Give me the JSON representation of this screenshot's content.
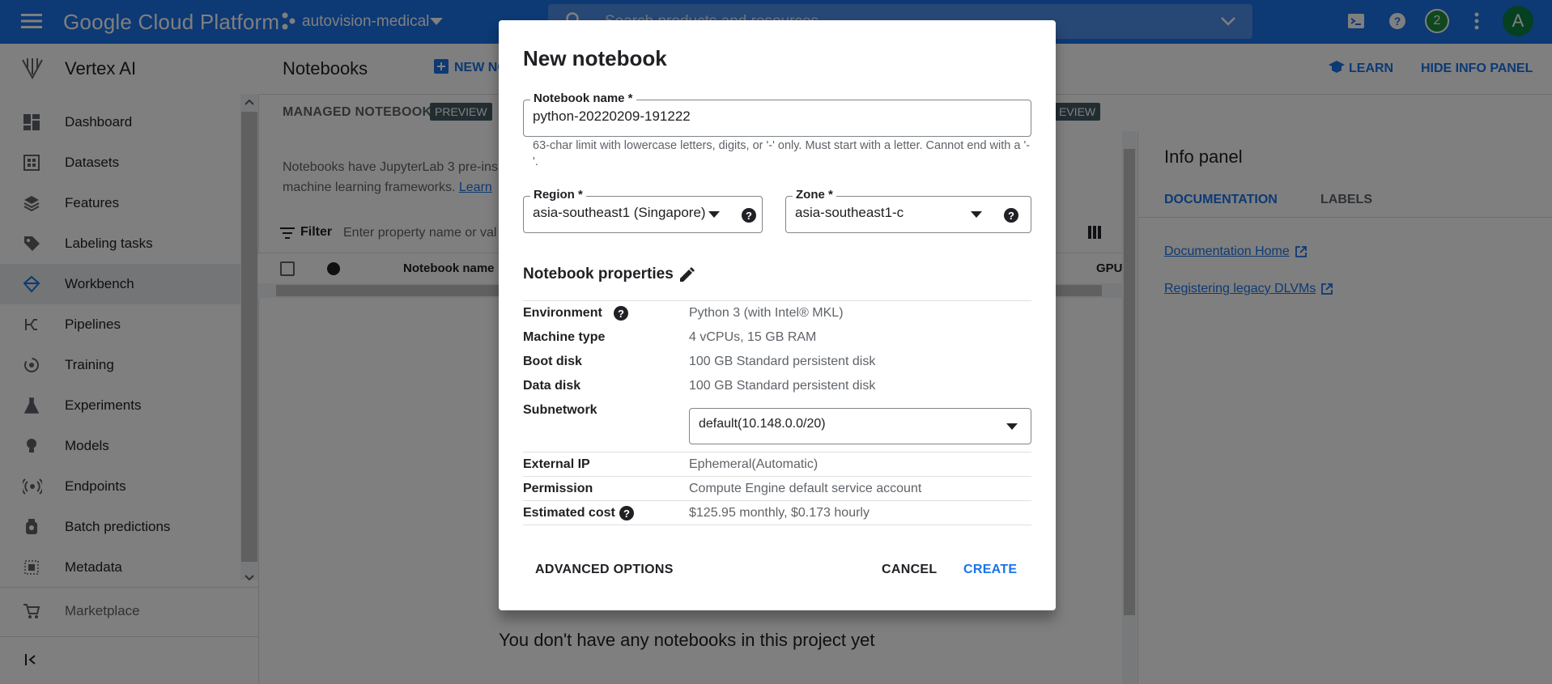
{
  "topbar": {
    "app_name": "Google Cloud Platform",
    "project": "autovision-medical",
    "search_placeholder": "Search products and resources",
    "notification_count": "2",
    "avatar_letter": "A"
  },
  "sidebar": {
    "product": "Vertex AI",
    "items": [
      {
        "label": "Dashboard",
        "icon": "dashboard-icon"
      },
      {
        "label": "Datasets",
        "icon": "datasets-icon"
      },
      {
        "label": "Features",
        "icon": "features-icon"
      },
      {
        "label": "Labeling tasks",
        "icon": "label-icon"
      },
      {
        "label": "Workbench",
        "icon": "workbench-icon",
        "active": true
      },
      {
        "label": "Pipelines",
        "icon": "pipelines-icon"
      },
      {
        "label": "Training",
        "icon": "training-icon"
      },
      {
        "label": "Experiments",
        "icon": "flask-icon"
      },
      {
        "label": "Models",
        "icon": "bulb-icon"
      },
      {
        "label": "Endpoints",
        "icon": "endpoints-icon"
      },
      {
        "label": "Batch predictions",
        "icon": "batch-icon"
      },
      {
        "label": "Metadata",
        "icon": "metadata-icon"
      }
    ],
    "marketplace": "Marketplace"
  },
  "main": {
    "title": "Notebooks",
    "new_button": "NEW NO",
    "tab_managed": "MANAGED NOTEBOOKS",
    "preview": "PREVIEW",
    "preview_right": "EVIEW",
    "info_line1": "Notebooks have JupyterLab 3 pre-ins",
    "info_line2": "machine learning frameworks.",
    "info_link": "Learn",
    "filter_label": "Filter",
    "filter_placeholder": "Enter property name or val",
    "col_name": "Notebook name",
    "col_gpu": "GPU",
    "empty_message": "You don't have any notebooks in this project yet"
  },
  "header_right": {
    "learn": "LEARN",
    "hide_info": "HIDE INFO PANEL"
  },
  "info_panel": {
    "title": "Info panel",
    "tab_documentation": "DOCUMENTATION",
    "tab_labels": "LABELS",
    "link1": "Documentation Home",
    "link2": "Registering legacy DLVMs"
  },
  "dialog": {
    "title": "New notebook",
    "name_label": "Notebook name *",
    "name_value": "python-20220209-191222",
    "name_hint": "63-char limit with lowercase letters, digits, or '-' only. Must start with a letter. Cannot end with a '-'.",
    "region_label": "Region *",
    "region_value": "asia-southeast1 (Singapore)",
    "zone_label": "Zone *",
    "zone_value": "asia-southeast1-c",
    "properties_title": "Notebook properties",
    "properties": {
      "environment": {
        "k": "Environment",
        "v": "Python 3 (with Intel® MKL)"
      },
      "machine": {
        "k": "Machine type",
        "v": "4 vCPUs, 15 GB RAM"
      },
      "boot": {
        "k": "Boot disk",
        "v": "100 GB Standard persistent disk"
      },
      "data": {
        "k": "Data disk",
        "v": "100 GB Standard persistent disk"
      },
      "subnetwork": {
        "k": "Subnetwork",
        "v": "default(10.148.0.0/20)"
      },
      "external_ip": {
        "k": "External IP",
        "v": "Ephemeral(Automatic)"
      },
      "permission": {
        "k": "Permission",
        "v": "Compute Engine default service account"
      },
      "cost": {
        "k": "Estimated cost",
        "v": "$125.95 monthly, $0.173 hourly"
      }
    },
    "advanced": "ADVANCED OPTIONS",
    "cancel": "CANCEL",
    "create": "CREATE"
  },
  "colors": {
    "brand_blue": "#1a73e8",
    "active_nav": "#e8eaed"
  }
}
